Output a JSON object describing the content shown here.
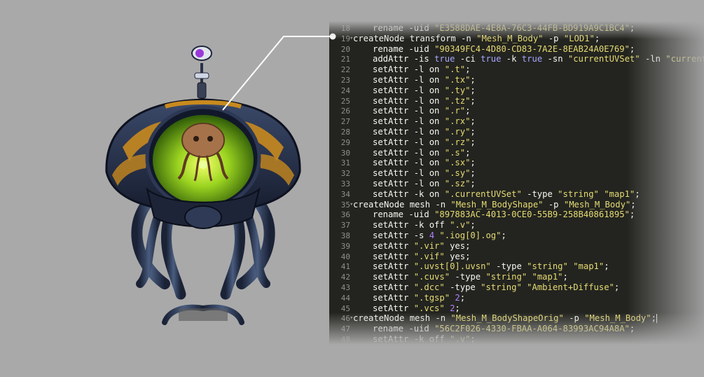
{
  "code_lines": [
    {
      "num": "18",
      "fold": false,
      "indent": true,
      "parts": [
        [
          "t",
          "rename -uid "
        ],
        [
          "s",
          "\"E3588DAE-4E8A-76C3-44FB-BD919A9C1BC4\""
        ],
        [
          "t",
          ";"
        ]
      ]
    },
    {
      "num": "19",
      "fold": true,
      "indent": false,
      "parts": [
        [
          "t",
          "createNode transform -n "
        ],
        [
          "s",
          "\"Mesh_M_Body\""
        ],
        [
          "t",
          " -p "
        ],
        [
          "s",
          "\"LOD1\""
        ],
        [
          "t",
          ";"
        ]
      ]
    },
    {
      "num": "20",
      "fold": false,
      "indent": true,
      "parts": [
        [
          "t",
          "rename -uid "
        ],
        [
          "s",
          "\"90349FC4-4D80-CD83-7A2E-8EAB24A0E769\""
        ],
        [
          "t",
          ";"
        ]
      ]
    },
    {
      "num": "21",
      "fold": false,
      "indent": true,
      "parts": [
        [
          "t",
          "addAttr -is "
        ],
        [
          "k",
          "true"
        ],
        [
          "t",
          " -ci "
        ],
        [
          "k",
          "true"
        ],
        [
          "t",
          " -k "
        ],
        [
          "k",
          "true"
        ],
        [
          "t",
          " -sn "
        ],
        [
          "s",
          "\"currentUVSet\""
        ],
        [
          "t",
          " -ln "
        ],
        [
          "s",
          "\"currentUVSet\""
        ]
      ]
    },
    {
      "num": "22",
      "fold": false,
      "indent": true,
      "parts": [
        [
          "t",
          "setAttr -l on "
        ],
        [
          "s",
          "\".t\""
        ],
        [
          "t",
          ";"
        ]
      ]
    },
    {
      "num": "23",
      "fold": false,
      "indent": true,
      "parts": [
        [
          "t",
          "setAttr -l on "
        ],
        [
          "s",
          "\".tx\""
        ],
        [
          "t",
          ";"
        ]
      ]
    },
    {
      "num": "24",
      "fold": false,
      "indent": true,
      "parts": [
        [
          "t",
          "setAttr -l on "
        ],
        [
          "s",
          "\".ty\""
        ],
        [
          "t",
          ";"
        ]
      ]
    },
    {
      "num": "25",
      "fold": false,
      "indent": true,
      "parts": [
        [
          "t",
          "setAttr -l on "
        ],
        [
          "s",
          "\".tz\""
        ],
        [
          "t",
          ";"
        ]
      ]
    },
    {
      "num": "26",
      "fold": false,
      "indent": true,
      "parts": [
        [
          "t",
          "setAttr -l on "
        ],
        [
          "s",
          "\".r\""
        ],
        [
          "t",
          ";"
        ]
      ]
    },
    {
      "num": "27",
      "fold": false,
      "indent": true,
      "parts": [
        [
          "t",
          "setAttr -l on "
        ],
        [
          "s",
          "\".rx\""
        ],
        [
          "t",
          ";"
        ]
      ]
    },
    {
      "num": "28",
      "fold": false,
      "indent": true,
      "parts": [
        [
          "t",
          "setAttr -l on "
        ],
        [
          "s",
          "\".ry\""
        ],
        [
          "t",
          ";"
        ]
      ]
    },
    {
      "num": "29",
      "fold": false,
      "indent": true,
      "parts": [
        [
          "t",
          "setAttr -l on "
        ],
        [
          "s",
          "\".rz\""
        ],
        [
          "t",
          ";"
        ]
      ]
    },
    {
      "num": "30",
      "fold": false,
      "indent": true,
      "parts": [
        [
          "t",
          "setAttr -l on "
        ],
        [
          "s",
          "\".s\""
        ],
        [
          "t",
          ";"
        ]
      ]
    },
    {
      "num": "31",
      "fold": false,
      "indent": true,
      "parts": [
        [
          "t",
          "setAttr -l on "
        ],
        [
          "s",
          "\".sx\""
        ],
        [
          "t",
          ";"
        ]
      ]
    },
    {
      "num": "32",
      "fold": false,
      "indent": true,
      "parts": [
        [
          "t",
          "setAttr -l on "
        ],
        [
          "s",
          "\".sy\""
        ],
        [
          "t",
          ";"
        ]
      ]
    },
    {
      "num": "33",
      "fold": false,
      "indent": true,
      "parts": [
        [
          "t",
          "setAttr -l on "
        ],
        [
          "s",
          "\".sz\""
        ],
        [
          "t",
          ";"
        ]
      ]
    },
    {
      "num": "34",
      "fold": false,
      "indent": true,
      "parts": [
        [
          "t",
          "setAttr -k on "
        ],
        [
          "s",
          "\".currentUVSet\""
        ],
        [
          "t",
          " -type "
        ],
        [
          "s",
          "\"string\""
        ],
        [
          "t",
          " "
        ],
        [
          "s",
          "\"map1\""
        ],
        [
          "t",
          ";"
        ]
      ]
    },
    {
      "num": "35",
      "fold": true,
      "indent": false,
      "parts": [
        [
          "t",
          "createNode mesh -n "
        ],
        [
          "s",
          "\"Mesh_M_BodyShape\""
        ],
        [
          "t",
          " -p "
        ],
        [
          "s",
          "\"Mesh_M_Body\""
        ],
        [
          "t",
          ";"
        ]
      ]
    },
    {
      "num": "36",
      "fold": false,
      "indent": true,
      "parts": [
        [
          "t",
          "rename -uid "
        ],
        [
          "s",
          "\"897883AC-4013-0CE0-55B9-258B40861895\""
        ],
        [
          "t",
          ";"
        ]
      ]
    },
    {
      "num": "37",
      "fold": false,
      "indent": true,
      "parts": [
        [
          "t",
          "setAttr -k off "
        ],
        [
          "s",
          "\".v\""
        ],
        [
          "t",
          ";"
        ]
      ]
    },
    {
      "num": "38",
      "fold": false,
      "indent": true,
      "parts": [
        [
          "t",
          "setAttr -s "
        ],
        [
          "n",
          "4"
        ],
        [
          "t",
          " "
        ],
        [
          "s",
          "\".iog[0].og\""
        ],
        [
          "t",
          ";"
        ]
      ]
    },
    {
      "num": "39",
      "fold": false,
      "indent": true,
      "parts": [
        [
          "t",
          "setAttr "
        ],
        [
          "s",
          "\".vir\""
        ],
        [
          "t",
          " yes;"
        ]
      ]
    },
    {
      "num": "40",
      "fold": false,
      "indent": true,
      "parts": [
        [
          "t",
          "setAttr "
        ],
        [
          "s",
          "\".vif\""
        ],
        [
          "t",
          " yes;"
        ]
      ]
    },
    {
      "num": "41",
      "fold": false,
      "indent": true,
      "parts": [
        [
          "t",
          "setAttr "
        ],
        [
          "s",
          "\".uvst[0].uvsn\""
        ],
        [
          "t",
          " -type "
        ],
        [
          "s",
          "\"string\""
        ],
        [
          "t",
          " "
        ],
        [
          "s",
          "\"map1\""
        ],
        [
          "t",
          ";"
        ]
      ]
    },
    {
      "num": "42",
      "fold": false,
      "indent": true,
      "parts": [
        [
          "t",
          "setAttr "
        ],
        [
          "s",
          "\".cuvs\""
        ],
        [
          "t",
          " -type "
        ],
        [
          "s",
          "\"string\""
        ],
        [
          "t",
          " "
        ],
        [
          "s",
          "\"map1\""
        ],
        [
          "t",
          ";"
        ]
      ]
    },
    {
      "num": "43",
      "fold": false,
      "indent": true,
      "parts": [
        [
          "t",
          "setAttr "
        ],
        [
          "s",
          "\".dcc\""
        ],
        [
          "t",
          " -type "
        ],
        [
          "s",
          "\"string\""
        ],
        [
          "t",
          " "
        ],
        [
          "s",
          "\"Ambient+Diffuse\""
        ],
        [
          "t",
          ";"
        ]
      ]
    },
    {
      "num": "44",
      "fold": false,
      "indent": true,
      "parts": [
        [
          "t",
          "setAttr "
        ],
        [
          "s",
          "\".tgsp\""
        ],
        [
          "t",
          " "
        ],
        [
          "n",
          "2"
        ],
        [
          "t",
          ";"
        ]
      ]
    },
    {
      "num": "45",
      "fold": false,
      "indent": true,
      "parts": [
        [
          "t",
          "setAttr "
        ],
        [
          "s",
          "\".vcs\""
        ],
        [
          "t",
          " "
        ],
        [
          "n",
          "2"
        ],
        [
          "t",
          ";"
        ]
      ]
    },
    {
      "num": "46",
      "fold": true,
      "indent": false,
      "cursor": true,
      "parts": [
        [
          "t",
          "createNode mesh -n "
        ],
        [
          "s",
          "\"Mesh_M_BodyShapeOrig\""
        ],
        [
          "t",
          " -p "
        ],
        [
          "s",
          "\"Mesh_M_Body\""
        ],
        [
          "t",
          ";"
        ]
      ]
    },
    {
      "num": "47",
      "fold": false,
      "indent": true,
      "parts": [
        [
          "t",
          "rename -uid "
        ],
        [
          "s",
          "\"56C2F026-4330-FBAA-A064-83993AC94A8A\""
        ],
        [
          "t",
          ";"
        ]
      ]
    },
    {
      "num": "48",
      "fold": false,
      "indent": true,
      "parts": [
        [
          "t",
          "setAttr -k off "
        ],
        [
          "s",
          "\".v\""
        ],
        [
          "t",
          ";"
        ]
      ]
    }
  ],
  "colors": {
    "background": "#a9a9a9",
    "editor_bg": "#23241f",
    "string": "#e6db74",
    "number": "#ae81ff",
    "keyword": "#a6a6ff",
    "text": "#f8f8f2",
    "gutter": "#8f908a"
  }
}
